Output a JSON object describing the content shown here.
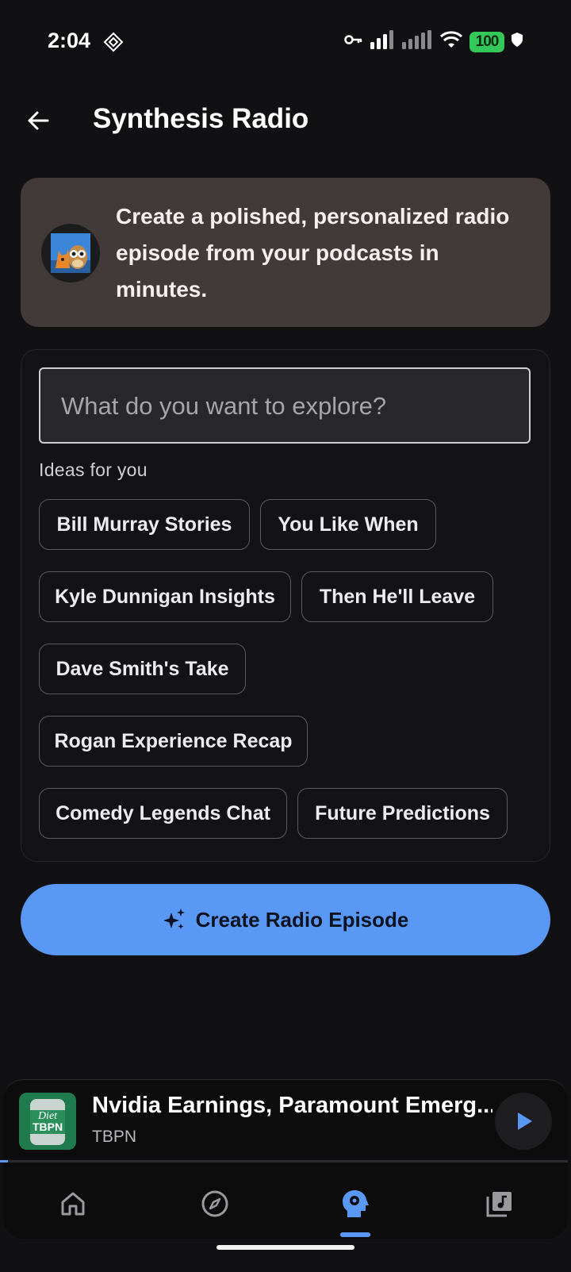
{
  "status_bar": {
    "time": "2:04",
    "battery": "100"
  },
  "app_bar": {
    "title": "Synthesis Radio"
  },
  "hero": {
    "text": "Create a polished, personalized radio episode from your podcasts in minutes."
  },
  "search": {
    "placeholder": "What do you want to explore?",
    "value": ""
  },
  "ideas": {
    "label": "Ideas for you",
    "chips": [
      "Bill Murray Stories",
      "You Like When",
      "Kyle Dunnigan Insights",
      "Then He'll Leave",
      "Dave Smith's Take",
      "Rogan Experience Recap",
      "Comedy Legends Chat",
      "Future Predictions"
    ]
  },
  "create_button": {
    "label": "Create Radio Episode",
    "icon": "sparkles-icon"
  },
  "mini_player": {
    "title": "Nvidia Earnings, Paramount Emerg...",
    "subtitle": "TBPN",
    "progress": 0.014
  },
  "bottom_nav": {
    "items": [
      "home-icon",
      "explore-compass-icon",
      "synthesis-head-icon",
      "library-music-icon"
    ],
    "active_index": 2
  },
  "colors": {
    "accent": "#5a98f6",
    "background": "#111113",
    "hero_card": "#413a38",
    "battery": "#34c759"
  }
}
